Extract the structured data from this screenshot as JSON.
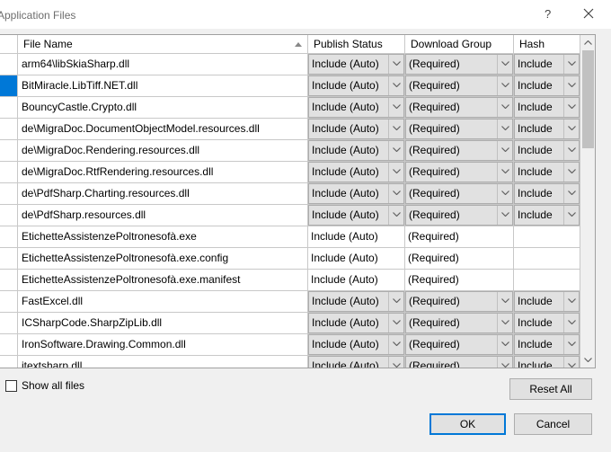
{
  "window": {
    "title": "Application Files",
    "help_label": "?"
  },
  "grid": {
    "columns": [
      "File Name",
      "Publish Status",
      "Download Group",
      "Hash"
    ],
    "rows": [
      {
        "file": "arm64\\libSkiaSharp.dll",
        "status": "Include (Auto)",
        "group": "(Required)",
        "hash": "Include",
        "dropdowns": true,
        "selected": false
      },
      {
        "file": "BitMiracle.LibTiff.NET.dll",
        "status": "Include (Auto)",
        "group": "(Required)",
        "hash": "Include",
        "dropdowns": true,
        "selected": true
      },
      {
        "file": "BouncyCastle.Crypto.dll",
        "status": "Include (Auto)",
        "group": "(Required)",
        "hash": "Include",
        "dropdowns": true,
        "selected": false
      },
      {
        "file": "de\\MigraDoc.DocumentObjectModel.resources.dll",
        "status": "Include (Auto)",
        "group": "(Required)",
        "hash": "Include",
        "dropdowns": true,
        "selected": false
      },
      {
        "file": "de\\MigraDoc.Rendering.resources.dll",
        "status": "Include (Auto)",
        "group": "(Required)",
        "hash": "Include",
        "dropdowns": true,
        "selected": false
      },
      {
        "file": "de\\MigraDoc.RtfRendering.resources.dll",
        "status": "Include (Auto)",
        "group": "(Required)",
        "hash": "Include",
        "dropdowns": true,
        "selected": false
      },
      {
        "file": "de\\PdfSharp.Charting.resources.dll",
        "status": "Include (Auto)",
        "group": "(Required)",
        "hash": "Include",
        "dropdowns": true,
        "selected": false
      },
      {
        "file": "de\\PdfSharp.resources.dll",
        "status": "Include (Auto)",
        "group": "(Required)",
        "hash": "Include",
        "dropdowns": true,
        "selected": false
      },
      {
        "file": "EtichetteAssistenzePoltronesofà.exe",
        "status": "Include (Auto)",
        "group": "(Required)",
        "hash": "",
        "dropdowns": false,
        "selected": false
      },
      {
        "file": "EtichetteAssistenzePoltronesofà.exe.config",
        "status": "Include (Auto)",
        "group": "(Required)",
        "hash": "",
        "dropdowns": false,
        "selected": false
      },
      {
        "file": "EtichetteAssistenzePoltronesofà.exe.manifest",
        "status": "Include (Auto)",
        "group": "(Required)",
        "hash": "",
        "dropdowns": false,
        "selected": false
      },
      {
        "file": "FastExcel.dll",
        "status": "Include (Auto)",
        "group": "(Required)",
        "hash": "Include",
        "dropdowns": true,
        "selected": false
      },
      {
        "file": "ICSharpCode.SharpZipLib.dll",
        "status": "Include (Auto)",
        "group": "(Required)",
        "hash": "Include",
        "dropdowns": true,
        "selected": false
      },
      {
        "file": "IronSoftware.Drawing.Common.dll",
        "status": "Include (Auto)",
        "group": "(Required)",
        "hash": "Include",
        "dropdowns": true,
        "selected": false
      },
      {
        "file": "itextsharp.dll",
        "status": "Include (Auto)",
        "group": "(Required)",
        "hash": "Include",
        "dropdowns": true,
        "selected": false
      }
    ]
  },
  "options": {
    "show_all_files": "Show all files",
    "show_all_checked": false
  },
  "buttons": {
    "reset_all": "Reset All",
    "ok": "OK",
    "cancel": "Cancel"
  },
  "colors": {
    "selection": "#0078d7",
    "default_button_border": "#0078d7"
  }
}
